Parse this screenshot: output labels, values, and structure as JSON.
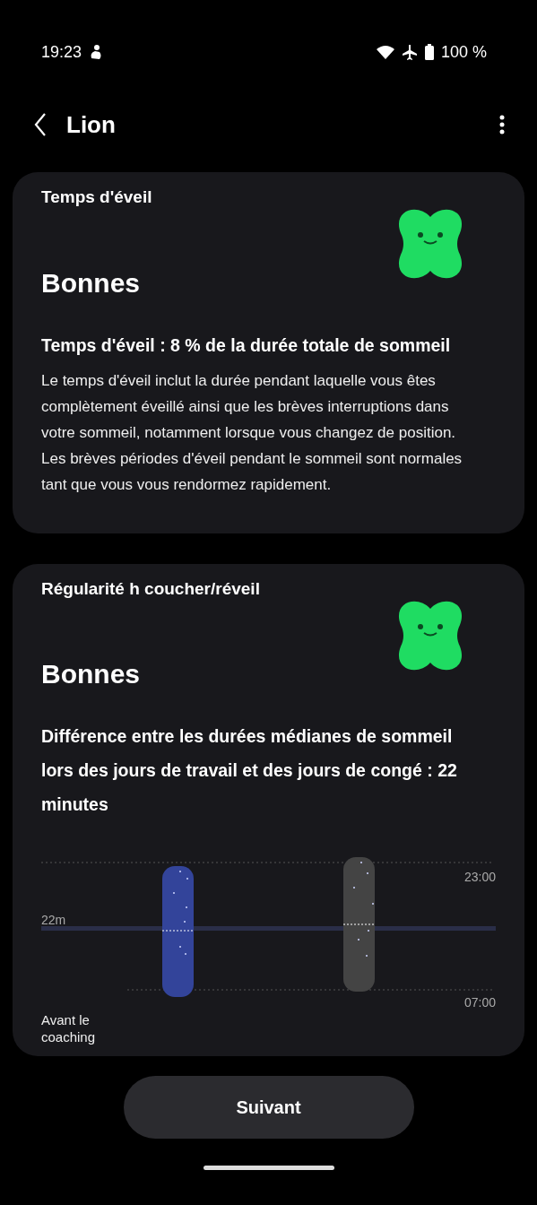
{
  "status_bar": {
    "time": "19:23",
    "battery": "100 %"
  },
  "header": {
    "title": "Lion"
  },
  "cards": [
    {
      "title": "Temps d'éveil",
      "rating": "Bonnes",
      "headline": "Temps d'éveil : 8 % de la durée totale de sommeil",
      "body": "Le temps d'éveil inclut la durée pendant laquelle vous êtes complètement éveillé ainsi que les brèves interruptions dans votre sommeil, notamment lorsque vous changez de position. Les brèves périodes d'éveil pendant le sommeil sont normales tant que vous vous rendormez rapidement."
    },
    {
      "title": "Régularité h coucher/réveil",
      "rating": "Bonnes",
      "headline": "Différence entre les durées médianes de sommeil lors des jours de travail et des jours de congé : 22 minutes",
      "chart": {
        "difference_label": "22m",
        "top_label": "23:00",
        "bottom_label": "07:00",
        "caption": "Avant le coaching"
      }
    }
  ],
  "button": {
    "label": "Suivant"
  }
}
